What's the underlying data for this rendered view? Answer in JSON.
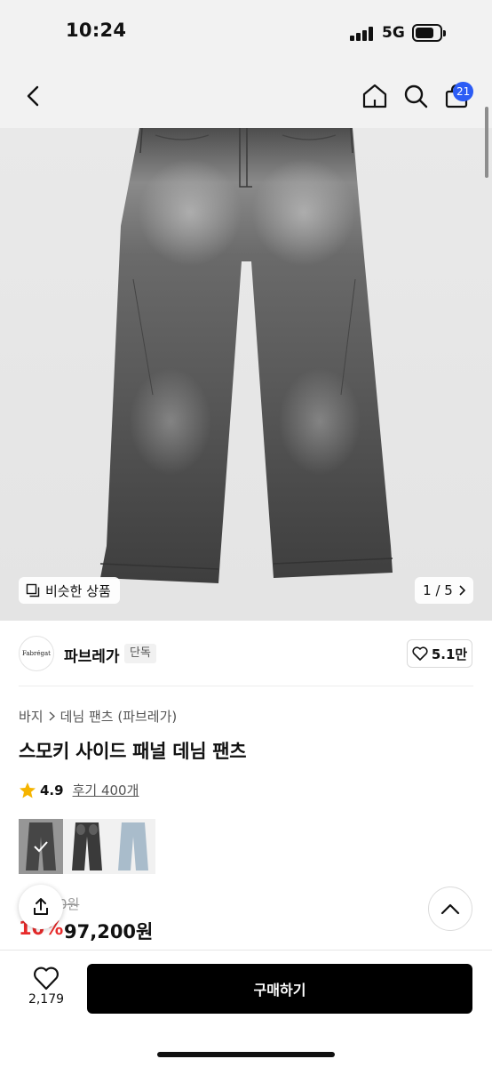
{
  "status_bar": {
    "time": "10:24",
    "network": "5G"
  },
  "header": {
    "cart_count": "21"
  },
  "hero": {
    "similar_label": "비슷한 상품",
    "page_indicator": "1 / 5"
  },
  "brand": {
    "logo_text": "Fabrégat",
    "name": "파브레가",
    "tag": "단독",
    "likes": "5.1만"
  },
  "product": {
    "breadcrumb": [
      "바지",
      "데님 팬츠 (파브레가)"
    ],
    "title": "스모키 사이드 패널 데님 팬츠",
    "rating": "4.9",
    "reviews": "후기 400개",
    "swatches": [
      "grey-wash",
      "black-wash",
      "light-blue-wash"
    ],
    "original_price": "0원",
    "discount": "10%",
    "price": "97,200원"
  },
  "bottom_bar": {
    "wish_count": "2,179",
    "buy_label": "구매하기"
  },
  "colors": {
    "accent_badge": "#2c5cf5",
    "discount": "#e82b2b",
    "buy_button": "#000000"
  }
}
